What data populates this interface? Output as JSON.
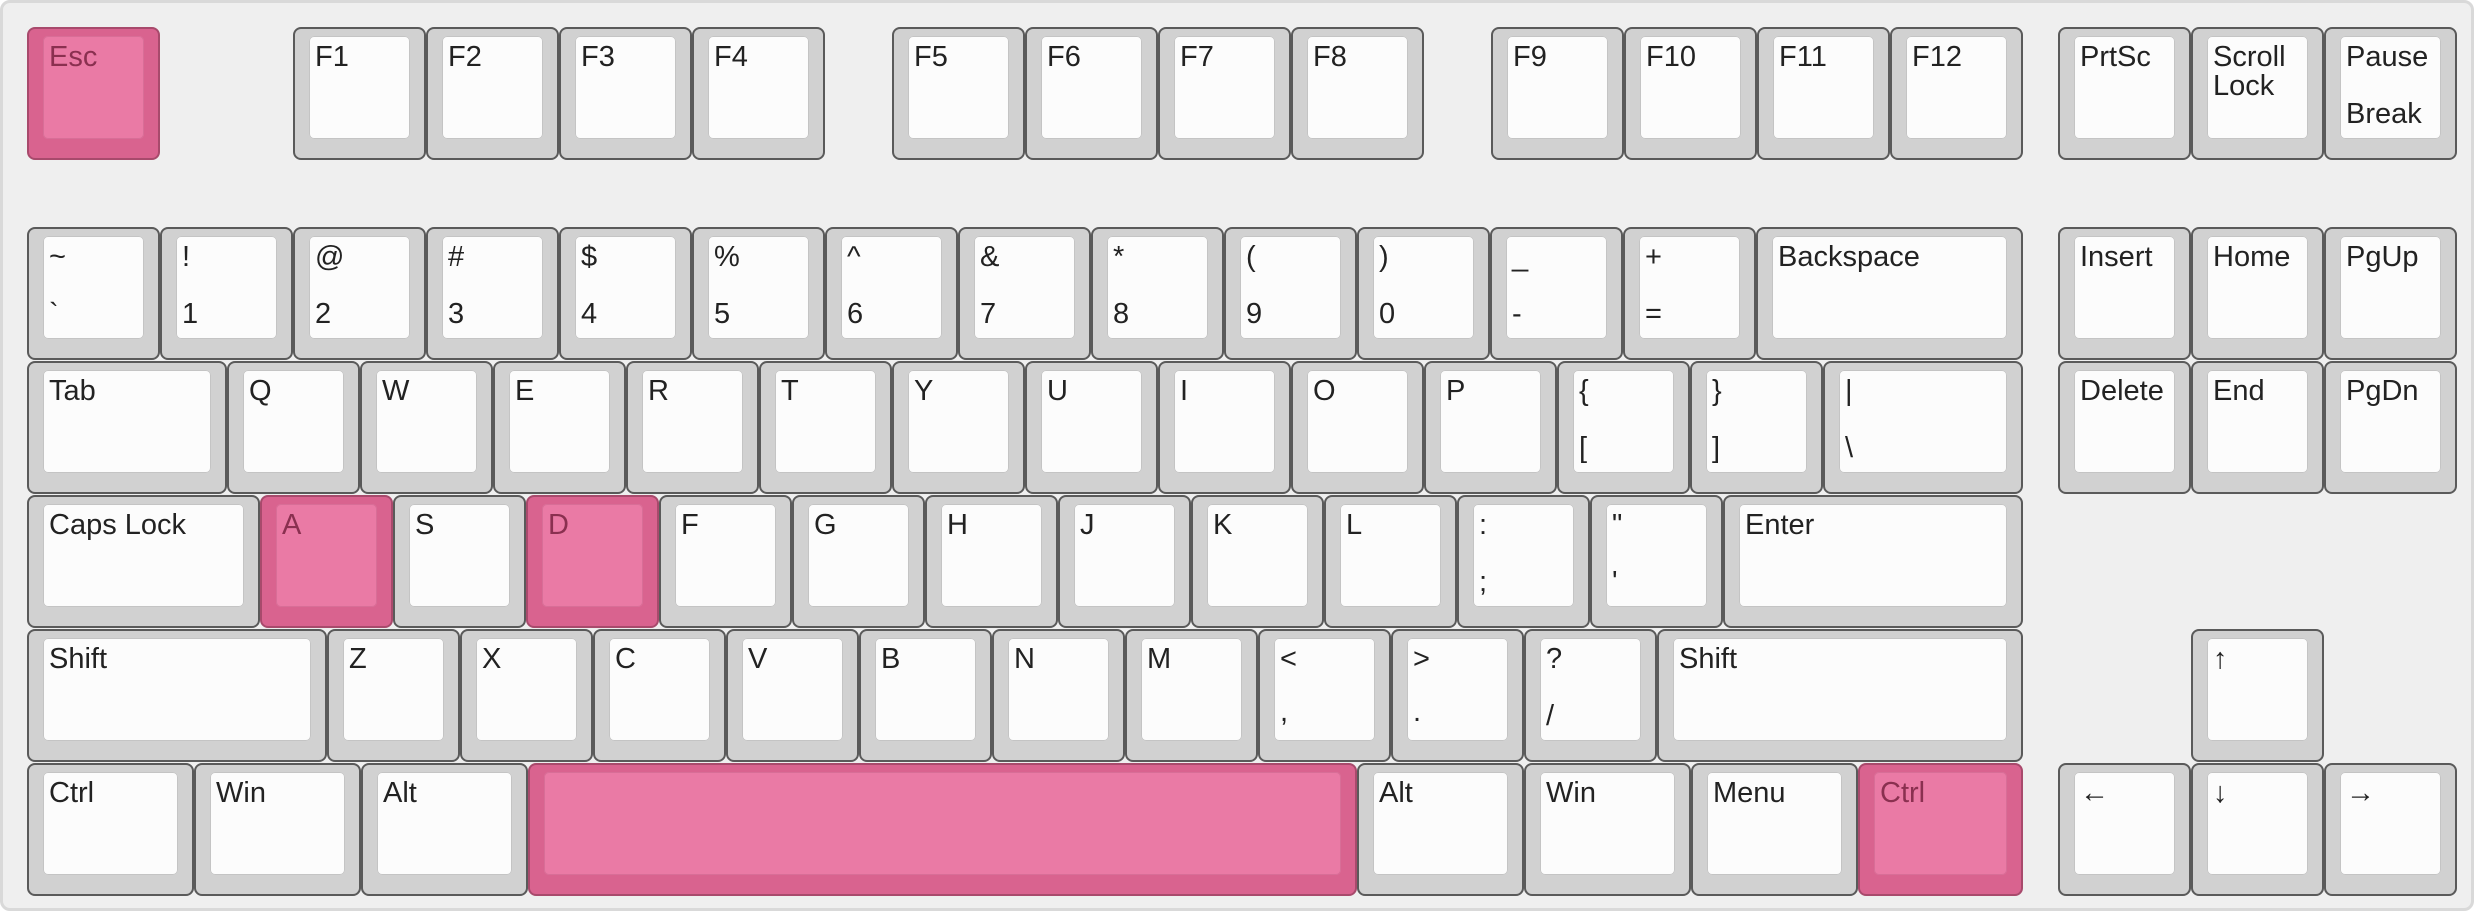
{
  "keyboard": {
    "highlight_color": "#ea7aa5",
    "key_face_color": "#fcfcfc",
    "key_border_color": "#d1d1d1",
    "background_color": "#efefef",
    "highlighted_keys": [
      "Esc",
      "A",
      "D",
      "Space",
      "Ctrl (right)"
    ],
    "function_row": {
      "esc": {
        "label": "Esc"
      },
      "f1": {
        "label": "F1"
      },
      "f2": {
        "label": "F2"
      },
      "f3": {
        "label": "F3"
      },
      "f4": {
        "label": "F4"
      },
      "f5": {
        "label": "F5"
      },
      "f6": {
        "label": "F6"
      },
      "f7": {
        "label": "F7"
      },
      "f8": {
        "label": "F8"
      },
      "f9": {
        "label": "F9"
      },
      "f10": {
        "label": "F10"
      },
      "f11": {
        "label": "F11"
      },
      "f12": {
        "label": "F12"
      },
      "prtsc": {
        "label": "PrtSc"
      },
      "scroll_lock": {
        "label": "Scroll\nLock"
      },
      "pause": {
        "top": "Pause",
        "bottom": "Break"
      }
    },
    "number_row": {
      "grave": {
        "top": "~",
        "bottom": "`"
      },
      "k1": {
        "top": "!",
        "bottom": "1"
      },
      "k2": {
        "top": "@",
        "bottom": "2"
      },
      "k3": {
        "top": "#",
        "bottom": "3"
      },
      "k4": {
        "top": "$",
        "bottom": "4"
      },
      "k5": {
        "top": "%",
        "bottom": "5"
      },
      "k6": {
        "top": "^",
        "bottom": "6"
      },
      "k7": {
        "top": "&",
        "bottom": "7"
      },
      "k8": {
        "top": "*",
        "bottom": "8"
      },
      "k9": {
        "top": "(",
        "bottom": "9"
      },
      "k0": {
        "top": ")",
        "bottom": "0"
      },
      "minus": {
        "top": "_",
        "bottom": "-"
      },
      "equals": {
        "top": "+",
        "bottom": "="
      },
      "backspace": {
        "label": "Backspace"
      }
    },
    "tab_row": {
      "tab": {
        "label": "Tab"
      },
      "q": {
        "label": "Q"
      },
      "w": {
        "label": "W"
      },
      "e": {
        "label": "E"
      },
      "r": {
        "label": "R"
      },
      "t": {
        "label": "T"
      },
      "y": {
        "label": "Y"
      },
      "u": {
        "label": "U"
      },
      "i": {
        "label": "I"
      },
      "o": {
        "label": "O"
      },
      "p": {
        "label": "P"
      },
      "lbracket": {
        "top": "{",
        "bottom": "["
      },
      "rbracket": {
        "top": "}",
        "bottom": "]"
      },
      "backslash": {
        "top": "|",
        "bottom": "\\"
      }
    },
    "home_row": {
      "caps": {
        "label": "Caps Lock"
      },
      "a": {
        "label": "A"
      },
      "s": {
        "label": "S"
      },
      "d": {
        "label": "D"
      },
      "f": {
        "label": "F"
      },
      "g": {
        "label": "G"
      },
      "h": {
        "label": "H"
      },
      "j": {
        "label": "J"
      },
      "k": {
        "label": "K"
      },
      "l": {
        "label": "L"
      },
      "semicolon": {
        "top": ":",
        "bottom": ";"
      },
      "quote": {
        "top": "\"",
        "bottom": "'"
      },
      "enter": {
        "label": "Enter"
      }
    },
    "shift_row": {
      "lshift": {
        "label": "Shift"
      },
      "z": {
        "label": "Z"
      },
      "x": {
        "label": "X"
      },
      "c": {
        "label": "C"
      },
      "v": {
        "label": "V"
      },
      "b": {
        "label": "B"
      },
      "n": {
        "label": "N"
      },
      "m": {
        "label": "M"
      },
      "comma": {
        "top": "<",
        "bottom": ","
      },
      "period": {
        "top": ">",
        "bottom": "."
      },
      "slash": {
        "top": "?",
        "bottom": "/"
      },
      "rshift": {
        "label": "Shift"
      }
    },
    "bottom_row": {
      "lctrl": {
        "label": "Ctrl"
      },
      "lwin": {
        "label": "Win"
      },
      "lalt": {
        "label": "Alt"
      },
      "space": {
        "label": ""
      },
      "ralt": {
        "label": "Alt"
      },
      "rwin": {
        "label": "Win"
      },
      "menu": {
        "label": "Menu"
      },
      "rctrl": {
        "label": "Ctrl"
      }
    },
    "nav_cluster": {
      "insert": {
        "label": "Insert"
      },
      "home": {
        "label": "Home"
      },
      "pgup": {
        "label": "PgUp"
      },
      "delete": {
        "label": "Delete"
      },
      "end": {
        "label": "End"
      },
      "pgdn": {
        "label": "PgDn"
      }
    },
    "arrows": {
      "up": {
        "label": "↑"
      },
      "left": {
        "label": "←"
      },
      "down": {
        "label": "↓"
      },
      "right": {
        "label": "→"
      }
    }
  }
}
